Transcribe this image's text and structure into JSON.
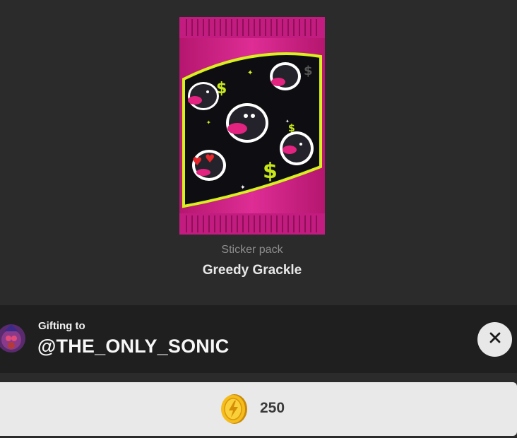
{
  "pack": {
    "type_label": "Sticker pack",
    "name": "Greedy Grackle",
    "image_icon": "sticker-pack-art",
    "colors": {
      "wrapper": "#d6288f",
      "wrapper_dark": "#a8136a",
      "stripe": "#d8f01e",
      "inner": "#0e0e12"
    }
  },
  "gift": {
    "label": "Gifting to",
    "recipient": "@THE_ONLY_SONIC",
    "avatar_icon": "user-avatar"
  },
  "close": {
    "icon": "close-icon",
    "glyph": "✕"
  },
  "purchase": {
    "price": "250",
    "currency_icon": "coin-icon",
    "coin_color": "#f2b418"
  },
  "colors": {
    "background": "#2b2b2b",
    "gift_bar": "#1f1f1f",
    "button": "#e9e9e9"
  }
}
